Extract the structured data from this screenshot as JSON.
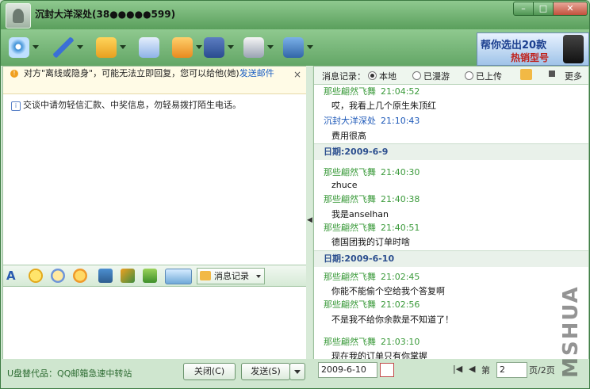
{
  "window": {
    "title": "沉封大洋深处(38",
    "title_obscured": "●●●●●599)",
    "controls": [
      "minimize",
      "maximize",
      "close"
    ]
  },
  "toolbar": {
    "icons": [
      "video-icon",
      "voice-icon",
      "file-transfer-icon",
      "email-icon",
      "sms-icon",
      "remote-assist-icon",
      "games-icon",
      "apps-icon"
    ],
    "ad_line1": "帮你选出20款",
    "ad_line2": "热销型号"
  },
  "notice": {
    "text": "对方\"离线或隐身\"，可能无法立即回复，您可以给他(她)",
    "link": "发送邮件",
    "close": "×"
  },
  "system_message": "交谈中请勿轻信汇款、中奖信息，勿轻易拨打陌生电话。",
  "format_bar": {
    "icons": [
      "font-icon",
      "emoticon-icon",
      "magic-face-icon",
      "sticker-icon",
      "image-icon",
      "screenshot-icon",
      "music-icon",
      "mode-icon"
    ],
    "history_button": "消息记录"
  },
  "footer": {
    "promo": "U盘替代品：QQ邮箱急速中转站",
    "close_button": "关闭(C)",
    "send_button": "发送(S)"
  },
  "history": {
    "label": "消息记录：",
    "options": [
      {
        "label": "本地",
        "selected": true
      },
      {
        "label": "已漫游",
        "selected": false
      },
      {
        "label": "已上传",
        "selected": false
      }
    ],
    "more": "更多",
    "entries": [
      {
        "kind": "msg",
        "sender": "那些翩然飞舞",
        "time": "21:04:52",
        "text": "哎，我看上几个原生朱顶红",
        "me": false
      },
      {
        "kind": "msg",
        "sender": "沉封大洋深处",
        "time": "21:10:43",
        "text": "费用很高",
        "me": true
      },
      {
        "kind": "date",
        "text": "日期:2009-6-9"
      },
      {
        "kind": "msg",
        "sender": "那些翩然飞舞",
        "time": "21:40:30",
        "text": "zhuce",
        "me": false
      },
      {
        "kind": "msg",
        "sender": "那些翩然飞舞",
        "time": "21:40:38",
        "text": "我是anselhan",
        "me": false
      },
      {
        "kind": "msg",
        "sender": "那些翩然飞舞",
        "time": "21:40:51",
        "text": "德国团我的订单时啥",
        "me": false
      },
      {
        "kind": "date",
        "text": "日期:2009-6-10"
      },
      {
        "kind": "msg",
        "sender": "那些翩然飞舞",
        "time": "21:02:45",
        "text": "你能不能偷个空给我个答复啊",
        "me": false
      },
      {
        "kind": "msg",
        "sender": "那些翩然飞舞",
        "time": "21:02:56",
        "text": "不是我不给你余款是不知道了！",
        "me": false
      },
      {
        "kind": "msg",
        "sender": "那些翩然飞舞",
        "time": "21:03:10",
        "text": "现在我的订单只有你掌握",
        "me": false
      }
    ],
    "date_value": "2009-6-10",
    "page_prefix": "第",
    "page_value": "2",
    "page_total": "页/2页",
    "watermark": "MSHUA"
  }
}
